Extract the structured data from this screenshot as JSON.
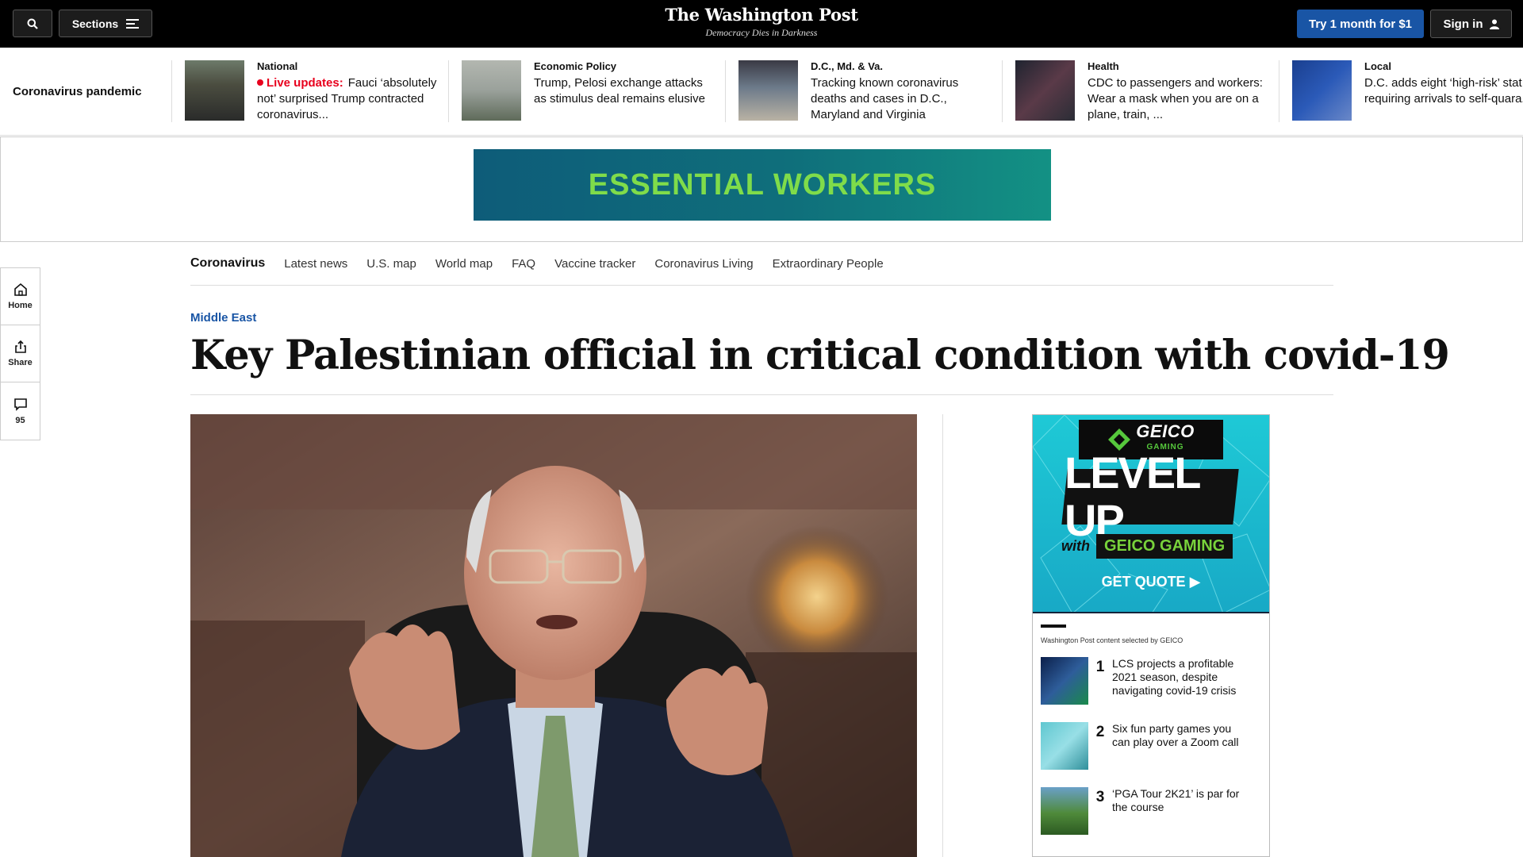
{
  "header": {
    "sections_label": "Sections",
    "logo_name": "The Washington Post",
    "logo_tagline": "Democracy Dies in Darkness",
    "subscribe_label": "Try 1 month for $1",
    "signin_label": "Sign in"
  },
  "ribbon": {
    "title": "Coronavirus pandemic",
    "stories": [
      {
        "kicker": "National",
        "live_label": "Live updates:",
        "headline": "Fauci ‘absolutely not’ surprised Trump contracted coronavirus..."
      },
      {
        "kicker": "Economic Policy",
        "headline": "Trump, Pelosi exchange attacks as stimulus deal remains elusive"
      },
      {
        "kicker": "D.C., Md. & Va.",
        "headline": "Tracking known coronavirus deaths and cases in D.C., Maryland and Virginia"
      },
      {
        "kicker": "Health",
        "headline": "CDC to passengers and workers: Wear a mask when you are on a plane, train, ..."
      },
      {
        "kicker": "Local",
        "headline": "D.C. adds eight ‘high-risk’ stat to list requiring arrivals to self-quara..."
      }
    ]
  },
  "banner_ad": {
    "text": "ESSENTIAL WORKERS"
  },
  "subnav": {
    "brand": "Coronavirus",
    "items": [
      "Latest news",
      "U.S. map",
      "World map",
      "FAQ",
      "Vaccine tracker",
      "Coronavirus Living",
      "Extraordinary People"
    ]
  },
  "rail": {
    "home_label": "Home",
    "share_label": "Share",
    "comments_count": "95"
  },
  "article": {
    "kicker": "Middle East",
    "headline": "Key Palestinian official in critical condition with covid-19"
  },
  "side_ad": {
    "brand": "GEICO",
    "brand_sub": "GAMING",
    "big_text": "LEVEL UP",
    "with": "with",
    "gaming": "GEICO GAMING",
    "cta": "GET QUOTE ▶",
    "selected_by": "Washington Post content selected by GEICO",
    "items": [
      {
        "num": "1",
        "title": "LCS projects a profitable 2021 season, despite navigating covid-19 crisis"
      },
      {
        "num": "2",
        "title": "Six fun party games you can play over a Zoom call"
      },
      {
        "num": "3",
        "title": "‘PGA Tour 2K21’ is par for the course"
      }
    ]
  },
  "colors": {
    "accent": "#1955a5",
    "live": "#e8001d",
    "topbar": "#000000"
  }
}
